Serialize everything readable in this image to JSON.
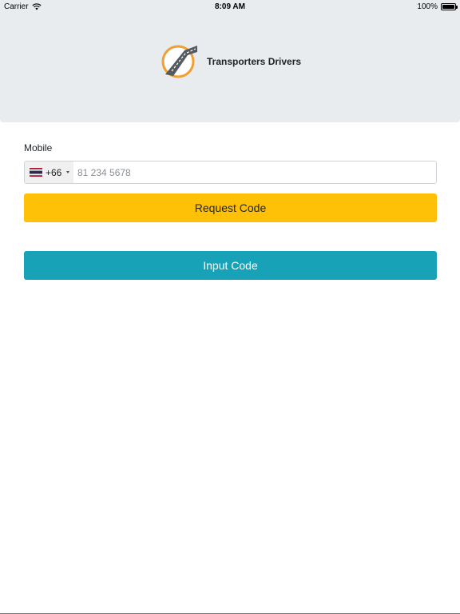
{
  "status_bar": {
    "carrier": "Carrier",
    "time": "8:09 AM",
    "battery": "100%"
  },
  "header": {
    "app_name": "Transporters Drivers",
    "logo_icon": "road-logo-icon"
  },
  "form": {
    "mobile_label": "Mobile",
    "country_code": "+66",
    "country_flag": "thailand-flag-icon",
    "phone_placeholder": "81 234 5678",
    "phone_value": ""
  },
  "buttons": {
    "request_code": "Request Code",
    "input_code": "Input Code"
  },
  "colors": {
    "header_bg": "#e9ecef",
    "request_button": "#ffc107",
    "input_button": "#17a2b8",
    "logo_ring": "#f0a030"
  }
}
